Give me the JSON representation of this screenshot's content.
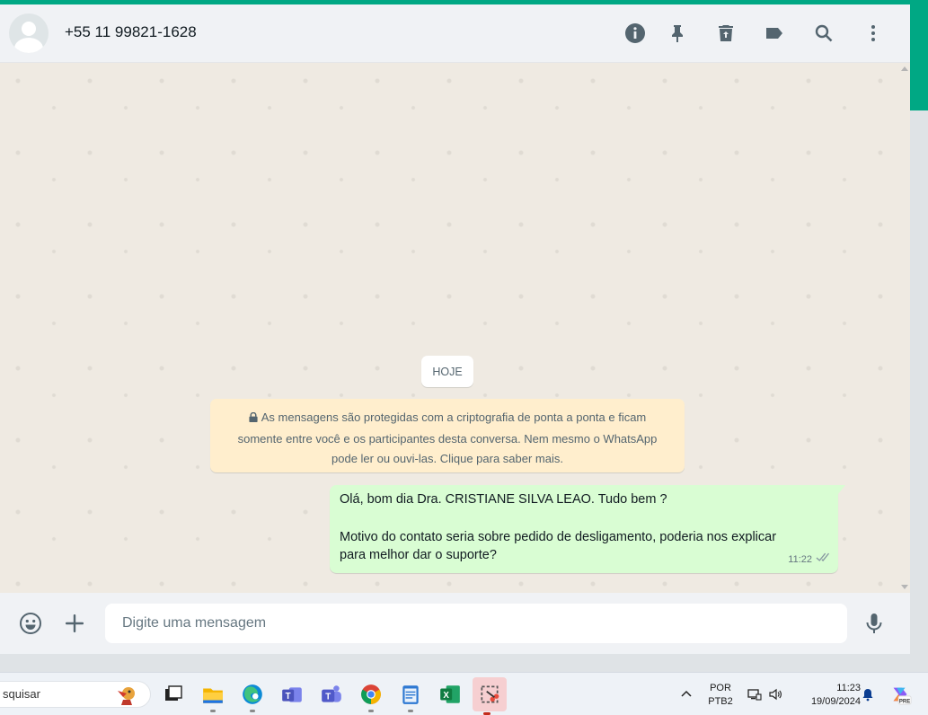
{
  "header": {
    "contact_name": "+55 11 99821-1628",
    "icons": [
      "info-icon",
      "pin-icon",
      "trash-icon",
      "label-icon",
      "search-icon",
      "more-icon"
    ]
  },
  "chat": {
    "date_divider": "HOJE",
    "encryption_notice": {
      "line1": "As mensagens são protegidas com a criptografia de ponta a ponta e ficam",
      "line2": "somente entre você e os participantes desta conversa. Nem mesmo o WhatsApp",
      "line3": "pode ler ou ouvi-las. Clique para saber mais."
    },
    "messages": [
      {
        "direction": "outgoing",
        "line1": "Olá, bom dia Dra. CRISTIANE SILVA LEAO. Tudo bem ?",
        "line2": "Motivo do contato seria sobre pedido de desligamento, poderia nos explicar",
        "line3": "para melhor dar o suporte?",
        "time": "11:22",
        "status": "delivered"
      }
    ]
  },
  "composer": {
    "placeholder": "Digite uma mensagem"
  },
  "taskbar": {
    "search_text": "squisar",
    "language_line1": "POR",
    "language_line2": "PTB2",
    "clock_time": "11:23",
    "clock_date": "19/09/2024",
    "copilot_badge": "PRE"
  },
  "colors": {
    "accent": "#00a884",
    "outgoing_bubble": "#d9fdd3",
    "notice_bg": "#ffeecd",
    "chat_bg": "#efeae2"
  }
}
